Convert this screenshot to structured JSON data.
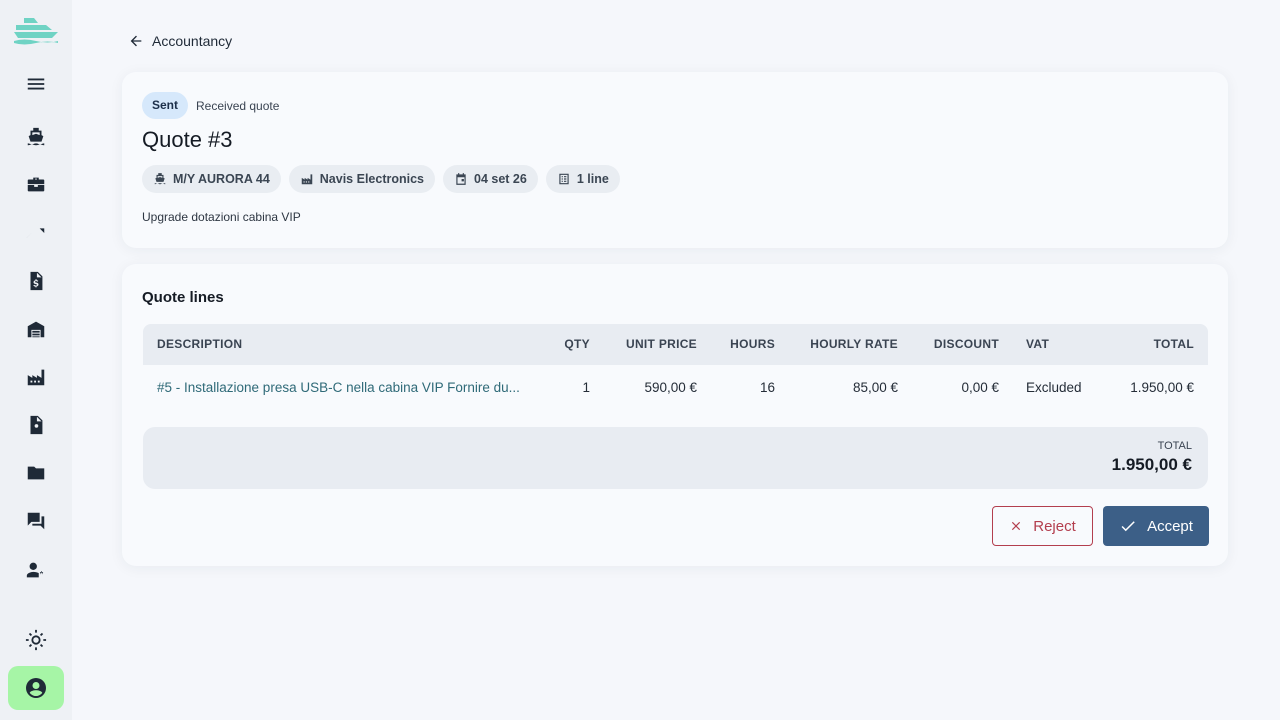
{
  "nav": {
    "back_label": "Accountancy"
  },
  "quote": {
    "status_badge": "Sent",
    "status_text": "Received quote",
    "title": "Quote #3",
    "chips": {
      "vessel": "M/Y AURORA 44",
      "supplier": "Navis Electronics",
      "date": "04 set 26",
      "lines": "1 line"
    },
    "description": "Upgrade dotazioni cabina VIP"
  },
  "lines_section": {
    "title": "Quote lines",
    "columns": {
      "description": "DESCRIPTION",
      "qty": "QTY",
      "unit_price": "UNIT PRICE",
      "hours": "HOURS",
      "hourly_rate": "HOURLY RATE",
      "discount": "DISCOUNT",
      "vat": "VAT",
      "total": "TOTAL"
    },
    "rows": [
      {
        "description": "#5 - Installazione presa USB-C nella cabina VIP Fornire du...",
        "qty": "1",
        "unit_price": "590,00 €",
        "hours": "16",
        "hourly_rate": "85,00 €",
        "discount": "0,00 €",
        "vat": "Excluded",
        "total": "1.950,00 €"
      }
    ],
    "totals_label": "TOTAL",
    "totals_value": "1.950,00 €"
  },
  "actions": {
    "reject_label": "Reject",
    "accept_label": "Accept"
  },
  "colors": {
    "accent": "#3c5f87",
    "danger": "#b33e4e",
    "user_button": "#a6f5a6",
    "badge_sent": "#d6e8fb",
    "logo": "#6fd3c4"
  },
  "icons": {
    "logo": "yacht-logo-icon",
    "sidebar": [
      "menu-icon",
      "ship-icon",
      "toolbox-icon",
      "trending-icon",
      "invoice-dollar-icon",
      "warehouse-icon",
      "factory-icon",
      "contact-document-icon",
      "folder-icon",
      "chat-icon",
      "user-settings-icon",
      "sun-icon",
      "account-circle-icon"
    ]
  }
}
